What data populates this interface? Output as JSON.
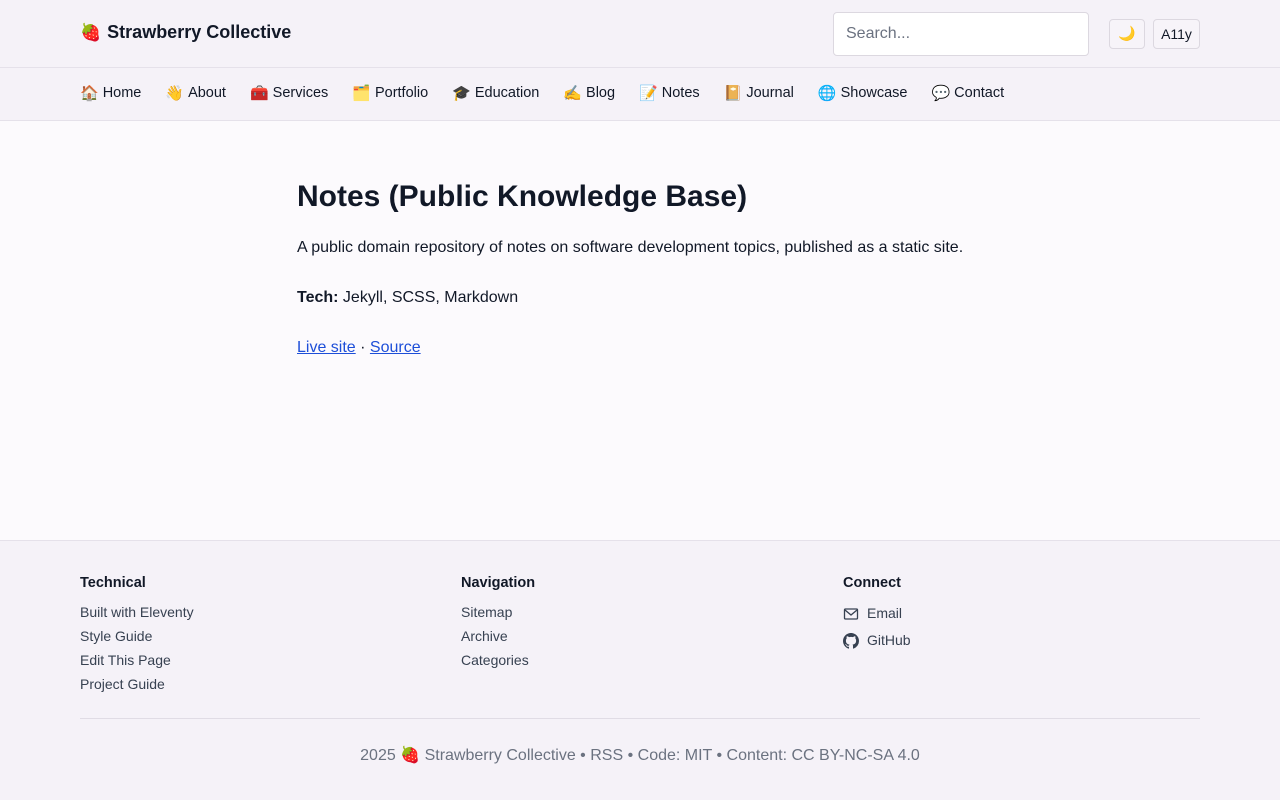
{
  "header": {
    "brand_icon": "🍓",
    "brand_name": "Strawberry Collective",
    "search_placeholder": "Search...",
    "theme_toggle_icon": "🌙",
    "a11y_label": "A11y"
  },
  "nav": {
    "items": [
      {
        "icon": "🏠",
        "label": "Home"
      },
      {
        "icon": "👋",
        "label": "About"
      },
      {
        "icon": "🧰",
        "label": "Services"
      },
      {
        "icon": "🗂️",
        "label": "Portfolio"
      },
      {
        "icon": "🎓",
        "label": "Education"
      },
      {
        "icon": "✍️",
        "label": "Blog"
      },
      {
        "icon": "📝",
        "label": "Notes"
      },
      {
        "icon": "📔",
        "label": "Journal"
      },
      {
        "icon": "🌐",
        "label": "Showcase"
      },
      {
        "icon": "💬",
        "label": "Contact"
      }
    ]
  },
  "main": {
    "title": "Notes (Public Knowledge Base)",
    "intro": "A public domain repository of notes on software development topics, published as a static site.",
    "tech_label": "Tech:",
    "tech_value": " Jekyll, SCSS, Markdown",
    "live_link": "Live site",
    "separator": " · ",
    "source_link": "Source"
  },
  "footer": {
    "technical": {
      "heading": "Technical",
      "items": [
        "Built with Eleventy",
        "Style Guide",
        "Edit This Page",
        "Project Guide"
      ]
    },
    "navigation": {
      "heading": "Navigation",
      "items": [
        "Sitemap",
        "Archive",
        "Categories"
      ]
    },
    "connect": {
      "heading": "Connect",
      "items": [
        {
          "icon": "mail-icon",
          "label": "Email"
        },
        {
          "icon": "github-icon",
          "label": "GitHub"
        }
      ]
    },
    "bottom": {
      "year": "2025",
      "brand_icon": "🍓",
      "brand_name": "Strawberry Collective",
      "rss": "RSS",
      "code_license": "Code: MIT",
      "content_license": "Content: CC BY-NC-SA 4.0",
      "bullet": " • "
    }
  }
}
